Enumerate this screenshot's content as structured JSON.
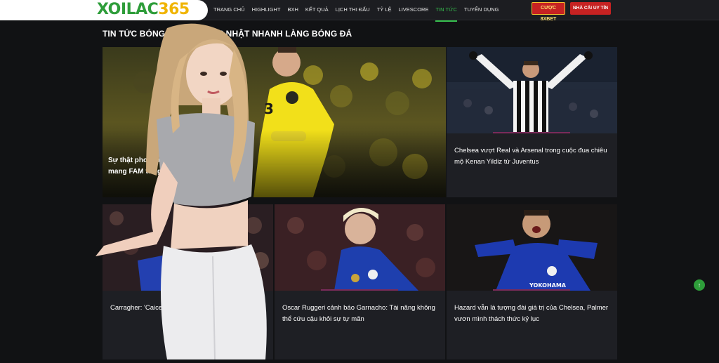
{
  "header": {
    "logo_part1": "XOILAC",
    "logo_part2": "365",
    "nav": [
      {
        "label": "TRANG CHỦ"
      },
      {
        "label": "HIGHLIGHT"
      },
      {
        "label": "BXH"
      },
      {
        "label": "KẾT QUẢ"
      },
      {
        "label": "LỊCH THI ĐẤU"
      },
      {
        "label": "TỶ LỆ"
      },
      {
        "label": "LIVESCORE"
      },
      {
        "label": "TIN TỨC",
        "active": true
      },
      {
        "label": "TUYỂN DỤNG"
      }
    ],
    "cta_bet": "CƯỢC 8XBET",
    "cta_bookie": "NHÀ CÁI UY TÍN"
  },
  "section_title": "TIN TỨC BÓNG ĐÁ 24H - CẬP NHẬT NHANH LÀNG BÓNG ĐÁ",
  "articles": {
    "featured": {
      "title": "Sự thật phơi bày: không mang FAM từng khả"
    },
    "top_right": {
      "title": "Chelsea vượt Real và Arsenal trong cuộc đua chiêu mộ Kenan Yildiz từ Juventus"
    },
    "bottom": [
      {
        "title": "Carragher: 'Caicedo và E thế giới'"
      },
      {
        "title": "Oscar Ruggeri cảnh báo Garnacho: Tài năng không thể cứu cậu khỏi sự tự mãn"
      },
      {
        "title": "Hazard vẫn là tượng đài giá trị của Chelsea, Palmer vươn mình thách thức kỷ lục"
      }
    ]
  },
  "colors": {
    "accent_green": "#37c04f",
    "brand_yellow": "#f0b400",
    "cta_red": "#c62222",
    "background": "#111214",
    "card_bg": "#1e1f24"
  },
  "icons": {
    "scroll_top": "arrow-up-icon"
  }
}
